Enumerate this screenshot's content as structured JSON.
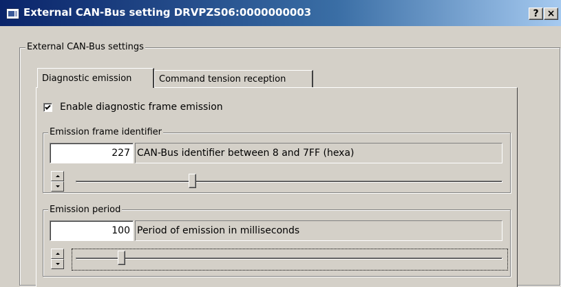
{
  "window": {
    "title": "External CAN-Bus setting DRVPZS06:0000000003",
    "help_label": "?",
    "close_label": "×"
  },
  "main_group": {
    "legend": "External CAN-Bus settings"
  },
  "tabs": [
    {
      "label": "Diagnostic emission",
      "active": true
    },
    {
      "label": "Command tension reception",
      "active": false
    }
  ],
  "diagnostic": {
    "enable_checkbox": {
      "label": "Enable diagnostic frame emission",
      "checked": true
    },
    "frame_identifier": {
      "legend": "Emission frame identifier",
      "value": "227",
      "description": "CAN-Bus identifier between 8 and 7FF (hexa)",
      "slider_position": 0.27
    },
    "period": {
      "legend": "Emission period",
      "value": "100",
      "description": "Period of emission in milliseconds",
      "slider_position": 0.1
    }
  },
  "icons": {
    "app": "application-window-icon",
    "spinner": "up-down-spinner-icon",
    "check": "checkmark-icon"
  }
}
